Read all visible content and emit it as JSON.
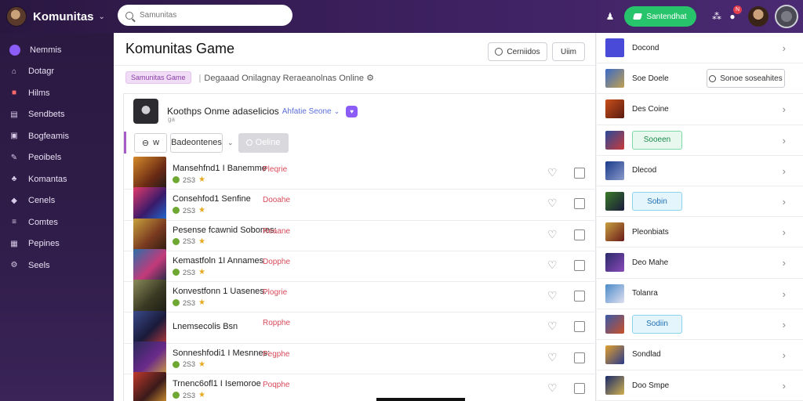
{
  "app": {
    "brand_name": "Komunitas",
    "search_placeholder": "Samunitas",
    "online_button_label": "Santendhat",
    "notification_count": "N"
  },
  "sidebar": {
    "items": [
      {
        "label": "Nemmis",
        "icon": "profile-dot-icon"
      },
      {
        "label": "Dotagr",
        "icon": "home-icon"
      },
      {
        "label": "Hilms",
        "icon": "gift-icon"
      },
      {
        "label": "Sendbets",
        "icon": "chat-icon"
      },
      {
        "label": "Bogfeamis",
        "icon": "controller-icon"
      },
      {
        "label": "Peoibels",
        "icon": "pin-icon"
      },
      {
        "label": "Komantas",
        "icon": "people-icon"
      },
      {
        "label": "Cenels",
        "icon": "tag-icon"
      },
      {
        "label": "Comtes",
        "icon": "layers-icon"
      },
      {
        "label": "Pepines",
        "icon": "grid-icon"
      },
      {
        "label": "Seels",
        "icon": "settings-icon"
      }
    ]
  },
  "main": {
    "title": "Komunitas Game",
    "header_buttons": [
      "Cerniidos",
      "Uiim"
    ],
    "tag_label": "Samunitas Game",
    "subtitle": "Degaaad Onilagnay Reraeanolnas Online",
    "group": {
      "name": "Koothps Onme adaselicios",
      "link": "Ahfatie Seone",
      "subtitle": "ga",
      "filter_left": "w",
      "filter_select": "Badeontenes",
      "disabled_button": "Oeline"
    },
    "rows": [
      {
        "title": "Mansehfnd1 I Banemme",
        "status": "Pleqrie",
        "count": "2S3"
      },
      {
        "title": "Consehfod1 Senfine",
        "status": "Dooahe",
        "count": "2S3"
      },
      {
        "title": "Pesense fcawnid Sobones:",
        "status": "Reaane",
        "count": "2S3"
      },
      {
        "title": "Kemastfoln 1I Annames",
        "status": "Dopphe",
        "count": "2S3"
      },
      {
        "title": "Konvestfonn 1 Uasenes:",
        "status": "Plogrie",
        "count": "2S3"
      },
      {
        "title": "Lnemsecolis Bsn",
        "status": "Ropphe",
        "count": ""
      },
      {
        "title": "Sonneshfodi1 I Mesnnes:",
        "status": "Pegphe",
        "count": "2S3"
      },
      {
        "title": "Trnenc6ofl1 I Isemoroe",
        "status": "Poqphe",
        "count": "2S3"
      }
    ]
  },
  "right_panel": {
    "items": [
      {
        "label": "Docond",
        "pill": ""
      },
      {
        "label": "Soe Doele",
        "pill": "Sonoe soseahites"
      },
      {
        "label": "Des Coine",
        "pill": ""
      },
      {
        "label": "",
        "pill": "Sooeen"
      },
      {
        "label": "Dlecod",
        "pill": ""
      },
      {
        "label": "",
        "pill": "Sobin"
      },
      {
        "label": "Pleonbiats",
        "pill": ""
      },
      {
        "label": "Deo Mahe",
        "pill": ""
      },
      {
        "label": "Tolanra",
        "pill": ""
      },
      {
        "label": "",
        "pill": "Sodiin"
      },
      {
        "label": "Sondlad",
        "pill": ""
      },
      {
        "label": "Doo Smpe",
        "pill": ""
      }
    ]
  },
  "colors": {
    "header_bg": "#3a1f5c",
    "sidebar_bg": "#2b1942",
    "accent_purple": "#8b5cf6",
    "online_green": "#27c46b",
    "status_red": "#d94a5a"
  }
}
